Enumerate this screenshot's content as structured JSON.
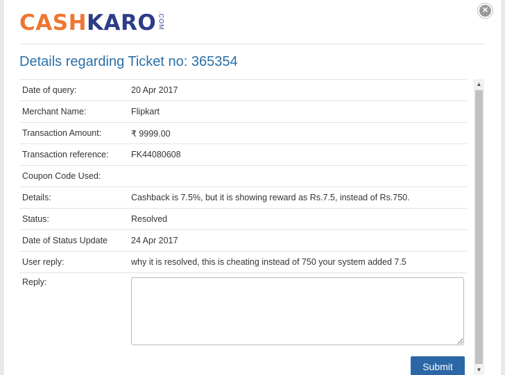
{
  "logo": {
    "part1": "CASH",
    "part2": "KARO",
    "suffix": ".COM"
  },
  "close_icon_glyph": "✕",
  "ticket": {
    "title": "Details regarding Ticket no: 365354",
    "rows": [
      {
        "label": "Date of query:",
        "value": "20 Apr 2017"
      },
      {
        "label": "Merchant Name:",
        "value": "Flipkart"
      },
      {
        "label": "Transaction Amount:",
        "value": "₹ 9999.00"
      },
      {
        "label": "Transaction reference:",
        "value": "FK44080608"
      },
      {
        "label": "Coupon Code Used:",
        "value": ""
      },
      {
        "label": "Details:",
        "value": "Cashback is 7.5%, but it is showing reward as Rs.7.5, instead of Rs.750."
      },
      {
        "label": "Status:",
        "value": "Resolved"
      },
      {
        "label": "Date of Status Update",
        "value": "24 Apr 2017"
      },
      {
        "label": "User reply:",
        "value": "why it is resolved, this is cheating instead of 750 your system added 7.5"
      }
    ],
    "reply_label": "Reply:",
    "reply_value": ""
  },
  "submit_label": "Submit",
  "scrollbar": {
    "up_glyph": "▲",
    "down_glyph": "▼"
  },
  "colors": {
    "brand_orange": "#ee7631",
    "brand_navy": "#2c3c87",
    "title_blue": "#2b6fa6",
    "button_blue": "#2b67a6"
  }
}
